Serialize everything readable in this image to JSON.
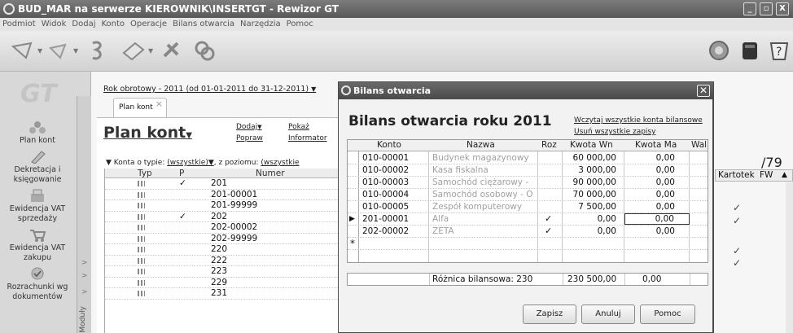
{
  "app": {
    "title": "BUD_MAR na serwerze KIEROWNIK\\INSERTGT - Rewizor GT",
    "minimize": "_",
    "maximize": "▫",
    "close": "X"
  },
  "menu": [
    "Podmiot",
    "Widok",
    "Dodaj",
    "Konto",
    "Operacje",
    "Bilans otwarcia",
    "Narzędzia",
    "Pomoc"
  ],
  "nav": {
    "logo": "GT",
    "items": [
      "Plan kont",
      "Dekretacja i księgowanie",
      "Ewidencja VAT sprzedaży",
      "Ewidencja VAT zakupu",
      "Rozrachunki wg dokumentów"
    ],
    "vertical_tab": "Moduły"
  },
  "plan": {
    "rok": "Rok obrotowy - 2011  (od 01-01-2011 do 31-12-2011)",
    "tab": "Plan kont",
    "title": "Plan kont",
    "links": {
      "dodaj": "Dodaj",
      "pokaz": "Pokaż",
      "popraw": "Popraw",
      "informator": "Informator"
    },
    "filter": {
      "label1": "Konta o typie:",
      "value1": "(wszystkie)",
      "label2": ", z poziomu:",
      "value2": "(wszystkie"
    },
    "columns": [
      "Typ",
      "P",
      "Numer"
    ],
    "rows": [
      {
        "p": "✓",
        "numer": "201"
      },
      {
        "p": "",
        "numer": "201-00001"
      },
      {
        "p": "",
        "numer": "201-99999"
      },
      {
        "p": "✓",
        "numer": "202"
      },
      {
        "p": "",
        "numer": "202-00002"
      },
      {
        "p": "",
        "numer": "202-99999"
      },
      {
        "p": "",
        "numer": "220"
      },
      {
        "p": "",
        "numer": "222"
      },
      {
        "p": "",
        "numer": "223"
      },
      {
        "p": "",
        "numer": "229"
      },
      {
        "p": "",
        "numer": "231"
      }
    ],
    "page_total": "/79",
    "right_columns": [
      "Kartotek",
      "FW"
    ],
    "kartotek_checks": [
      "✓",
      "✓",
      "✓",
      "✓"
    ]
  },
  "dialog": {
    "title": "Bilans otwarcia",
    "heading": "Bilans otwarcia roku 2011",
    "link_load": "Wczytaj wszystkie konta bilansowe",
    "link_clear": "Usuń wszystkie zapisy",
    "columns": [
      "Konto",
      "Nazwa",
      "Roz",
      "Kwota Wn",
      "Kwota Ma",
      "Wal"
    ],
    "rows": [
      {
        "konto": "010-00001",
        "nazwa": "Budynek magazynowy",
        "roz": "",
        "wn": "60 000,00",
        "ma": "0,00"
      },
      {
        "konto": "010-00002",
        "nazwa": "Kasa fiskalna",
        "roz": "",
        "wn": "3 000,00",
        "ma": "0,00"
      },
      {
        "konto": "010-00003",
        "nazwa": "Samochód ciężarowy -",
        "roz": "",
        "wn": "90 000,00",
        "ma": "0,00"
      },
      {
        "konto": "010-00004",
        "nazwa": "Samochód osobowy - O",
        "roz": "",
        "wn": "70 000,00",
        "ma": "0,00"
      },
      {
        "konto": "010-00005",
        "nazwa": "Zespół komputerowy",
        "roz": "",
        "wn": "7 500,00",
        "ma": "0,00"
      },
      {
        "konto": "201-00001",
        "nazwa": "Alfa",
        "roz": "✓",
        "wn": "0,00",
        "ma": "0,00"
      },
      {
        "konto": "202-00002",
        "nazwa": "ZETA",
        "roz": "✓",
        "wn": "0,00",
        "ma": "0,00"
      }
    ],
    "current_marker": "▶",
    "new_row_marker": "*",
    "roznica_label": "Różnica bilansowa: 230",
    "roznica_wn": "230 500,00",
    "roznica_ma": "0,00",
    "buttons": {
      "zapisz": "Zapisz",
      "anuluj": "Anuluj",
      "pomoc": "Pomoc"
    }
  }
}
